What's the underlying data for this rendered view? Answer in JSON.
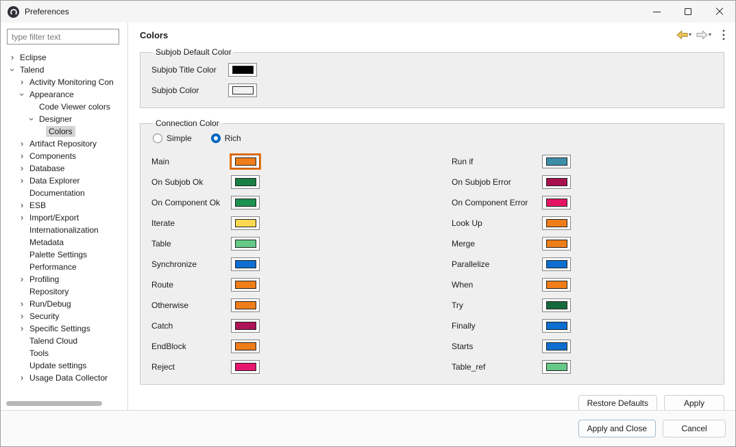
{
  "window": {
    "title": "Preferences"
  },
  "sidebar": {
    "filter_placeholder": "type filter text",
    "tree": [
      {
        "label": "Eclipse",
        "indent": 0,
        "chevron": "right"
      },
      {
        "label": "Talend",
        "indent": 0,
        "chevron": "down"
      },
      {
        "label": "Activity Monitoring Con",
        "indent": 1,
        "chevron": "right"
      },
      {
        "label": "Appearance",
        "indent": 1,
        "chevron": "down"
      },
      {
        "label": "Code Viewer colors",
        "indent": 2,
        "chevron": "none"
      },
      {
        "label": "Designer",
        "indent": 2,
        "chevron": "down"
      },
      {
        "label": "Colors",
        "indent": 3,
        "chevron": "none",
        "selected": true
      },
      {
        "label": "Artifact Repository",
        "indent": 1,
        "chevron": "right"
      },
      {
        "label": "Components",
        "indent": 1,
        "chevron": "right"
      },
      {
        "label": "Database",
        "indent": 1,
        "chevron": "right"
      },
      {
        "label": "Data Explorer",
        "indent": 1,
        "chevron": "right"
      },
      {
        "label": "Documentation",
        "indent": 1,
        "chevron": "none"
      },
      {
        "label": "ESB",
        "indent": 1,
        "chevron": "right"
      },
      {
        "label": "Import/Export",
        "indent": 1,
        "chevron": "right"
      },
      {
        "label": "Internationalization",
        "indent": 1,
        "chevron": "none"
      },
      {
        "label": "Metadata",
        "indent": 1,
        "chevron": "none"
      },
      {
        "label": "Palette Settings",
        "indent": 1,
        "chevron": "none"
      },
      {
        "label": "Performance",
        "indent": 1,
        "chevron": "none"
      },
      {
        "label": "Profiling",
        "indent": 1,
        "chevron": "right"
      },
      {
        "label": "Repository",
        "indent": 1,
        "chevron": "none"
      },
      {
        "label": "Run/Debug",
        "indent": 1,
        "chevron": "right"
      },
      {
        "label": "Security",
        "indent": 1,
        "chevron": "right"
      },
      {
        "label": "Specific Settings",
        "indent": 1,
        "chevron": "right"
      },
      {
        "label": "Talend Cloud",
        "indent": 1,
        "chevron": "none"
      },
      {
        "label": "Tools",
        "indent": 1,
        "chevron": "none"
      },
      {
        "label": "Update settings",
        "indent": 1,
        "chevron": "none"
      },
      {
        "label": "Usage Data Collector",
        "indent": 1,
        "chevron": "right"
      }
    ]
  },
  "main": {
    "title": "Colors",
    "subjob_group": {
      "title": "Subjob Default Color",
      "rows": [
        {
          "label": "Subjob Title Color",
          "color": "#000000"
        },
        {
          "label": "Subjob Color",
          "color": "#f2f2f2"
        }
      ]
    },
    "connection_group": {
      "title": "Connection Color",
      "radios": [
        {
          "label": "Simple",
          "checked": false
        },
        {
          "label": "Rich",
          "checked": true
        }
      ],
      "left_rows": [
        {
          "label": "Main",
          "color": "#EF7D1A",
          "focused": true
        },
        {
          "label": "On Subjob Ok",
          "color": "#188044"
        },
        {
          "label": "On Component Ok",
          "color": "#1C9150"
        },
        {
          "label": "Iterate",
          "color": "#FBD850"
        },
        {
          "label": "Table",
          "color": "#66C987"
        },
        {
          "label": "Synchronize",
          "color": "#0E6FD1"
        },
        {
          "label": "Route",
          "color": "#EF7D1A"
        },
        {
          "label": "Otherwise",
          "color": "#EF7D1A"
        },
        {
          "label": "Catch",
          "color": "#AE1357"
        },
        {
          "label": "EndBlock",
          "color": "#EF7D1A"
        },
        {
          "label": "Reject",
          "color": "#E8176E"
        }
      ],
      "right_rows": [
        {
          "label": "Run if",
          "color": "#3D8FA9"
        },
        {
          "label": "On Subjob Error",
          "color": "#A8104E"
        },
        {
          "label": "On Component Error",
          "color": "#E31563"
        },
        {
          "label": "Look Up",
          "color": "#EF7D1A"
        },
        {
          "label": "Merge",
          "color": "#EF7D1A"
        },
        {
          "label": "Parallelize",
          "color": "#0E6FD1"
        },
        {
          "label": "When",
          "color": "#EF7D1A"
        },
        {
          "label": "Try",
          "color": "#156A3C"
        },
        {
          "label": "Finally",
          "color": "#0E6FD1"
        },
        {
          "label": "Starts",
          "color": "#0E6FD1"
        },
        {
          "label": "Table_ref",
          "color": "#66C987"
        }
      ]
    },
    "buttons": {
      "restore_defaults": "Restore Defaults",
      "apply": "Apply"
    }
  },
  "footer": {
    "apply_and_close": "Apply and Close",
    "cancel": "Cancel"
  },
  "colors": {
    "radio_accent": "#0067C0",
    "focus_ring": "#E87511",
    "selection_bg": "#D5D5D5"
  }
}
